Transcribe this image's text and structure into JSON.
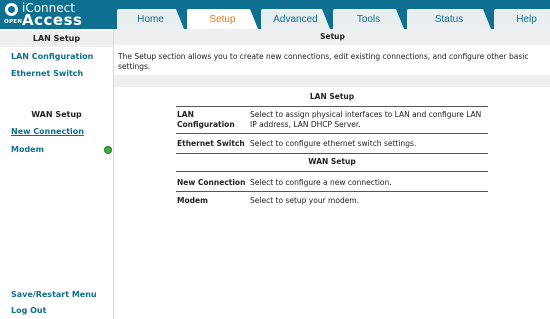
{
  "logo": {
    "open": "OPEN",
    "line1": "iConnect",
    "line2": "Access"
  },
  "tabs": [
    {
      "label": "Home",
      "active": false
    },
    {
      "label": "Setup",
      "active": true
    },
    {
      "label": "Advanced",
      "active": false
    },
    {
      "label": "Tools",
      "active": false
    },
    {
      "label": "Status",
      "active": false
    },
    {
      "label": "Help",
      "active": false
    }
  ],
  "sidebar": {
    "lan_header": "LAN Setup",
    "lan_configuration": "LAN Configuration",
    "ethernet_switch": "Ethernet Switch",
    "wan_header": "WAN Setup",
    "new_connection": "New Connection",
    "modem": "Modem",
    "save_restart": "Save/Restart Menu",
    "log_out": "Log Out"
  },
  "main": {
    "title": "Setup",
    "intro": "The Setup section allows you to create new connections, edit existing connections, and configure other basic settings.",
    "lan_table_header": "LAN Setup",
    "wan_table_header": "WAN Setup",
    "rows": {
      "lan_config_label_1": "LAN",
      "lan_config_label_2": "Configuration",
      "lan_config_desc": "Select to assign physical interfaces to LAN and configure LAN IP address, LAN DHCP Server.",
      "eth_switch_label": "Ethernet Switch",
      "eth_switch_desc": "Select to configure ethernet switch settings.",
      "new_conn_label": "New Connection",
      "new_conn_desc": "Select to configure a new connection.",
      "modem_label": "Modem",
      "modem_desc": "Select to setup your modem."
    }
  },
  "colors": {
    "brand": "#0e6f90",
    "active_tab": "#e07a1f",
    "panel": "#eef0f0"
  }
}
